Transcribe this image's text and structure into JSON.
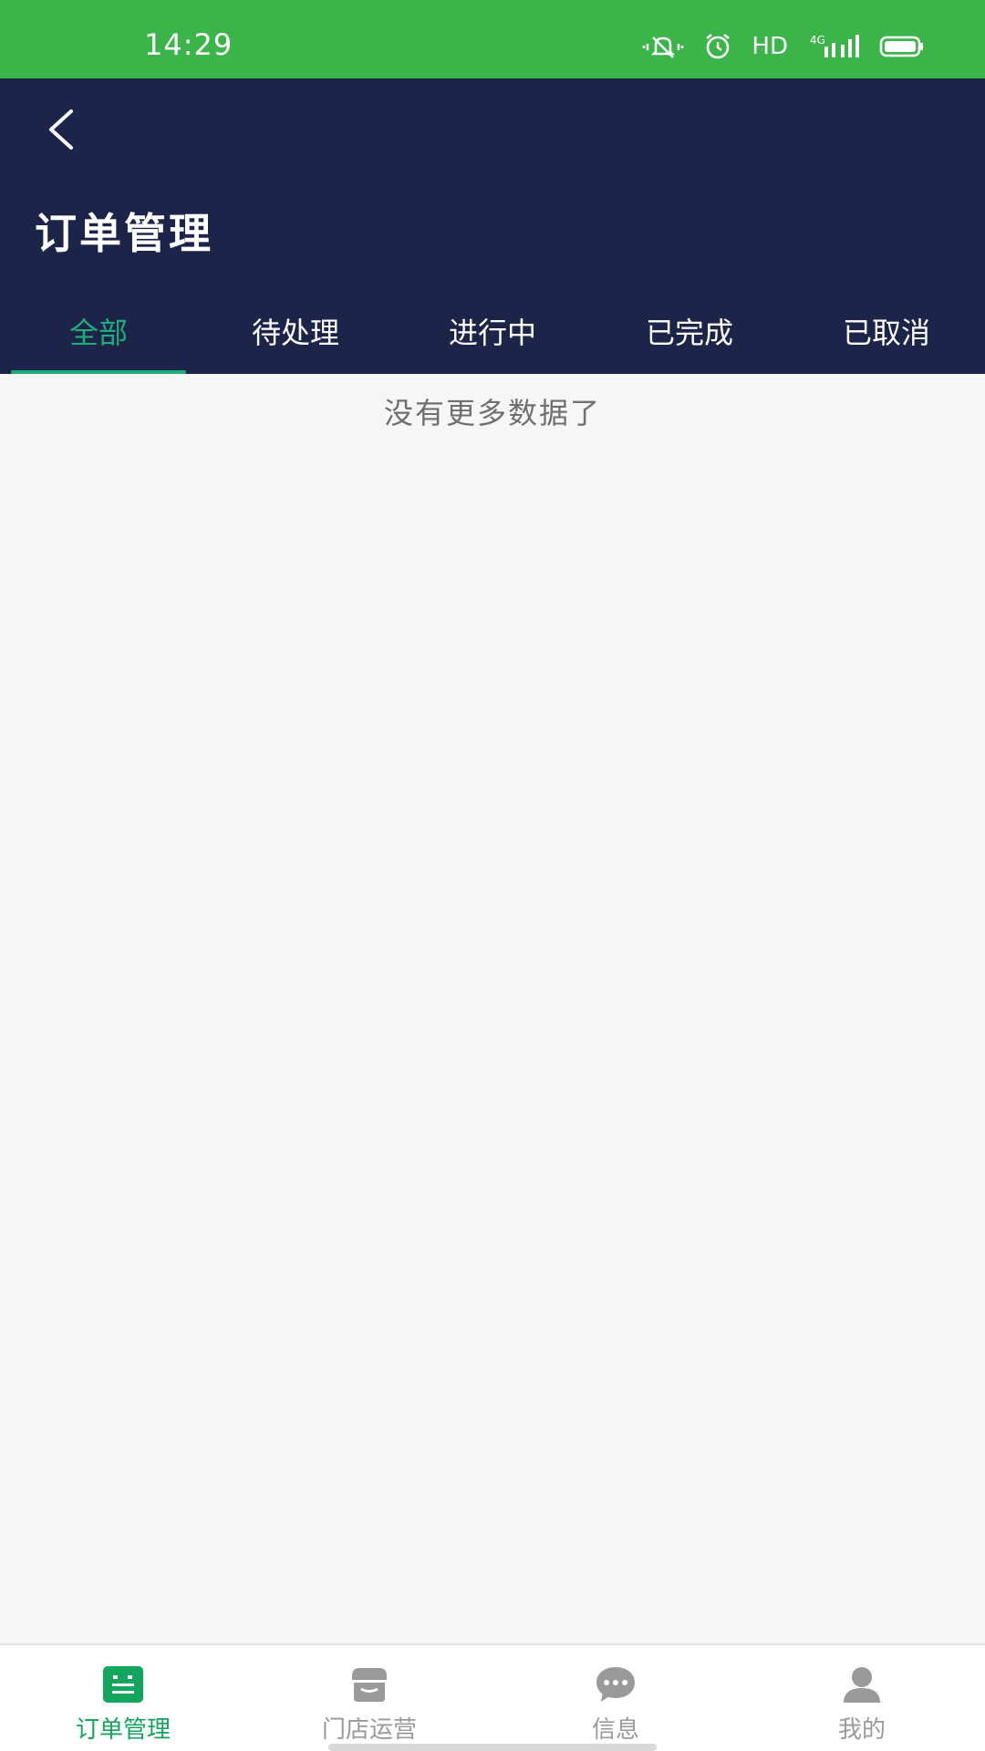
{
  "status_bar": {
    "time": "14:29",
    "hd": "HD",
    "network": "4G",
    "icons": [
      "vibrate-icon",
      "alarm-icon",
      "signal-icon",
      "battery-icon"
    ],
    "color": "#3bb54a"
  },
  "header": {
    "title": "订单管理",
    "back_icon": "chevron-left-icon",
    "background": "#1c2449"
  },
  "tabs": [
    {
      "label": "全部",
      "active": true
    },
    {
      "label": "待处理",
      "active": false
    },
    {
      "label": "进行中",
      "active": false
    },
    {
      "label": "已完成",
      "active": false
    },
    {
      "label": "已取消",
      "active": false
    }
  ],
  "content": {
    "empty_message": "没有更多数据了"
  },
  "bottom_nav": [
    {
      "label": "订单管理",
      "icon": "order-list-icon",
      "active": true
    },
    {
      "label": "门店运营",
      "icon": "store-icon",
      "active": false
    },
    {
      "label": "信息",
      "icon": "chat-bubble-icon",
      "active": false
    },
    {
      "label": "我的",
      "icon": "user-icon",
      "active": false
    }
  ],
  "colors": {
    "accent": "#1fae79",
    "nav_active": "#11a55e",
    "nav_inactive": "#9a9a9a"
  }
}
